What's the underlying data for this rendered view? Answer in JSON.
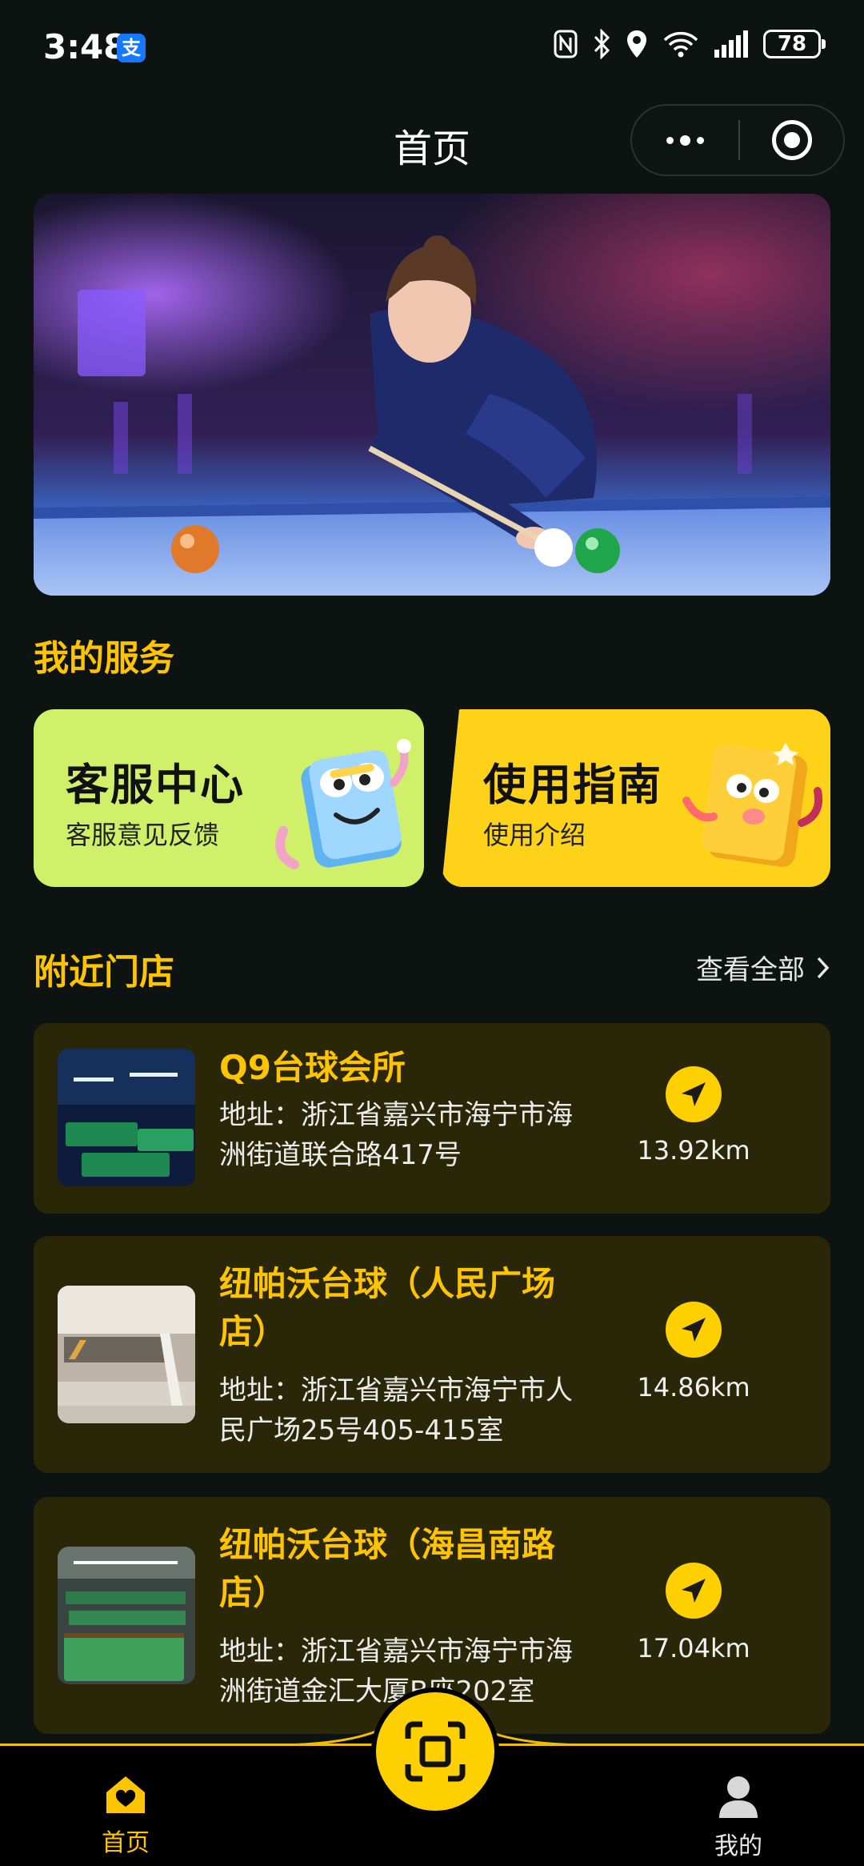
{
  "status_bar": {
    "time": "3:48",
    "alipay_badge": "支",
    "battery": "78"
  },
  "nav": {
    "title": "首页"
  },
  "services": {
    "section_title": "我的服务",
    "cards": [
      {
        "title": "客服中心",
        "subtitle": "客服意见反馈",
        "color": "#d1f06a"
      },
      {
        "title": "使用指南",
        "subtitle": "使用介绍",
        "color": "#ffd21a"
      }
    ]
  },
  "nearby": {
    "section_title": "附近门店",
    "view_all": "查看全部",
    "stores": [
      {
        "name": "Q9台球会所",
        "address": "地址：浙江省嘉兴市海宁市海洲街道联合路417号",
        "distance": "13.92km"
      },
      {
        "name": "纽帕沃台球（人民广场店）",
        "address": "地址：浙江省嘉兴市海宁市人民广场25号405-415室",
        "distance": "14.86km"
      },
      {
        "name": "纽帕沃台球（海昌南路店）",
        "address": "地址：浙江省嘉兴市海宁市海洲街道金汇大厦B座202室",
        "distance": "17.04km"
      }
    ]
  },
  "tabbar": {
    "home_label": "首页",
    "me_label": "我的"
  },
  "colors": {
    "accent": "#ffc400",
    "background": "#0c1311",
    "card_background": "#2a2708"
  }
}
